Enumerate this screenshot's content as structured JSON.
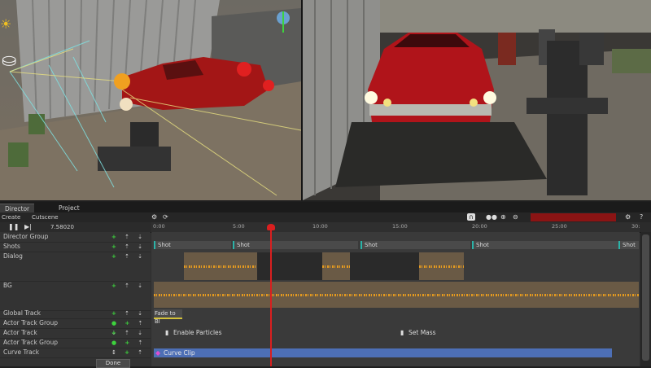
{
  "tabs": [
    {
      "label": "Director"
    },
    {
      "label": "Project"
    }
  ],
  "toolbar": {
    "create_label": "Create",
    "cutscene_label": "Cutscene",
    "time": "7.58020"
  },
  "ruler_ticks": [
    "0:00",
    "5:00",
    "10:00",
    "15:00",
    "20:00",
    "25:00",
    "30:"
  ],
  "tracks": [
    {
      "label": "Director Group"
    },
    {
      "label": "Shots"
    },
    {
      "label": "Dialog"
    },
    {
      "label": "BG"
    },
    {
      "label": "Global Track"
    },
    {
      "label": "Actor Track Group"
    },
    {
      "label": "Actor Track"
    },
    {
      "label": "Actor Track Group"
    },
    {
      "label": "Curve Track"
    }
  ],
  "shots": [
    {
      "label": "Shot"
    },
    {
      "label": "Shot"
    },
    {
      "label": "Shot"
    },
    {
      "label": "Shot"
    },
    {
      "label": "Shot"
    }
  ],
  "clips": {
    "fade_label": "Fade to Bl",
    "enable_particles_label": "Enable Particles",
    "set_mass_label": "Set Mass",
    "curve_clip_label": "Curve Clip"
  },
  "done_label": "Done",
  "colors": {
    "playhead": "#d91f1f",
    "curve_clip": "#4d6fb6",
    "audio_wave": "#e49a20",
    "shot_marker": "#2bb3a8",
    "record": "#8b1414"
  },
  "playhead_time_label": "7.58020"
}
